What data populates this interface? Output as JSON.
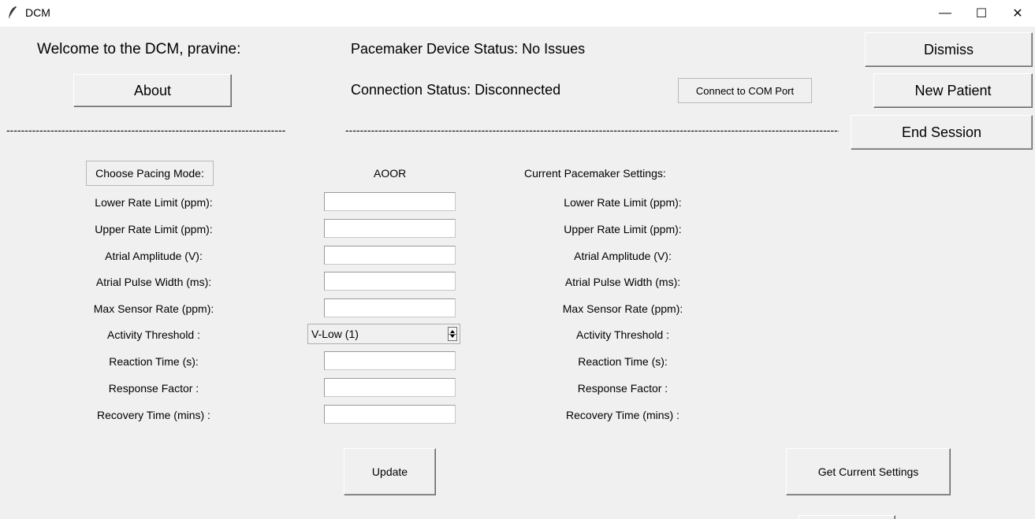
{
  "window": {
    "title": "DCM",
    "icon": "feather-icon",
    "controls": {
      "minimize": "—",
      "maximize": "☐",
      "close": "✕"
    }
  },
  "header": {
    "welcome": "Welcome to the DCM, pravine:",
    "device_status": "Pacemaker Device Status: No Issues",
    "connection_status": "Connection Status:  Disconnected"
  },
  "buttons": {
    "about": "About",
    "connect": "Connect to COM Port",
    "dismiss": "Dismiss",
    "new_patient": "New Patient",
    "end_session": "End Session",
    "update": "Update",
    "get_current": "Get Current Settings"
  },
  "dividers": {
    "left": "----------------------------------------------------------------------------",
    "right": "-----------------------------------------------------------------------------------------------------------------------------------------------------------------------"
  },
  "form": {
    "choose_mode_label": "Choose Pacing Mode:",
    "mode_value": "AOOR",
    "fields": [
      {
        "label": "Lower Rate Limit (ppm):",
        "value": ""
      },
      {
        "label": "Upper Rate Limit (ppm):",
        "value": ""
      },
      {
        "label": "Atrial Amplitude (V):",
        "value": ""
      },
      {
        "label": "Atrial Pulse Width (ms):",
        "value": ""
      },
      {
        "label": "Max Sensor Rate (ppm):",
        "value": ""
      },
      {
        "label": "Activity Threshold :",
        "value": "V-Low (1)"
      },
      {
        "label": "Reaction Time (s):",
        "value": ""
      },
      {
        "label": "Response Factor :",
        "value": ""
      },
      {
        "label": "Recovery Time (mins) :",
        "value": ""
      }
    ]
  },
  "current": {
    "heading": "Current Pacemaker Settings:",
    "labels": [
      "Lower Rate Limit (ppm):",
      "Upper Rate Limit (ppm):",
      "Atrial Amplitude (V):",
      "Atrial Pulse Width (ms):",
      "Max Sensor Rate (ppm):",
      "Activity Threshold :",
      "Reaction Time (s):",
      "Response Factor :",
      "Recovery Time (mins) :"
    ]
  }
}
